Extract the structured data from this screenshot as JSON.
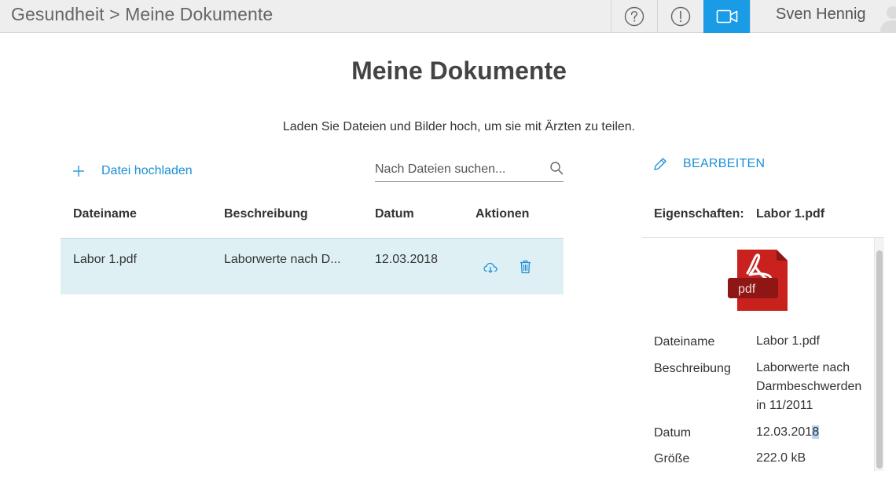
{
  "topbar": {
    "breadcrumb": "Gesundheit > Meine Dokumente",
    "help_icon": "question-circle-icon",
    "alert_icon": "exclamation-circle-icon",
    "video_icon": "video-camera-icon",
    "user_name": "Sven Hennig",
    "accent_color": "#1a9be6"
  },
  "main": {
    "title": "Meine Dokumente",
    "subtitle": "Laden Sie Dateien und Bilder hoch, um sie mit Ärzten zu teilen.",
    "upload_label": "Datei hochladen",
    "search_placeholder": "Nach Dateien suchen...",
    "search_value": ""
  },
  "table": {
    "columns": [
      "Dateiname",
      "Beschreibung",
      "Datum",
      "Aktionen"
    ],
    "rows": [
      {
        "name": "Labor 1.pdf",
        "description": "Laborwerte nach D...",
        "date": "12.03.2018",
        "actions": [
          "cloud-download-icon",
          "trash-icon"
        ]
      }
    ],
    "selected_row_color": "#dff0f4"
  },
  "details": {
    "edit_label": "BEARBEITEN",
    "properties_label": "Eigenschaften:",
    "properties_file": "Labor 1.pdf",
    "file_type_badge": "pdf",
    "fields": [
      {
        "label": "Dateiname",
        "value": "Labor 1.pdf"
      },
      {
        "label": "Beschreibung",
        "value": "Laborwerte nach Darmbeschwerden in 11/2011"
      },
      {
        "label": "Datum",
        "value_main": "12.03.201",
        "value_highlight": "8"
      },
      {
        "label": "Größe",
        "value": "222.0 kB"
      }
    ]
  }
}
